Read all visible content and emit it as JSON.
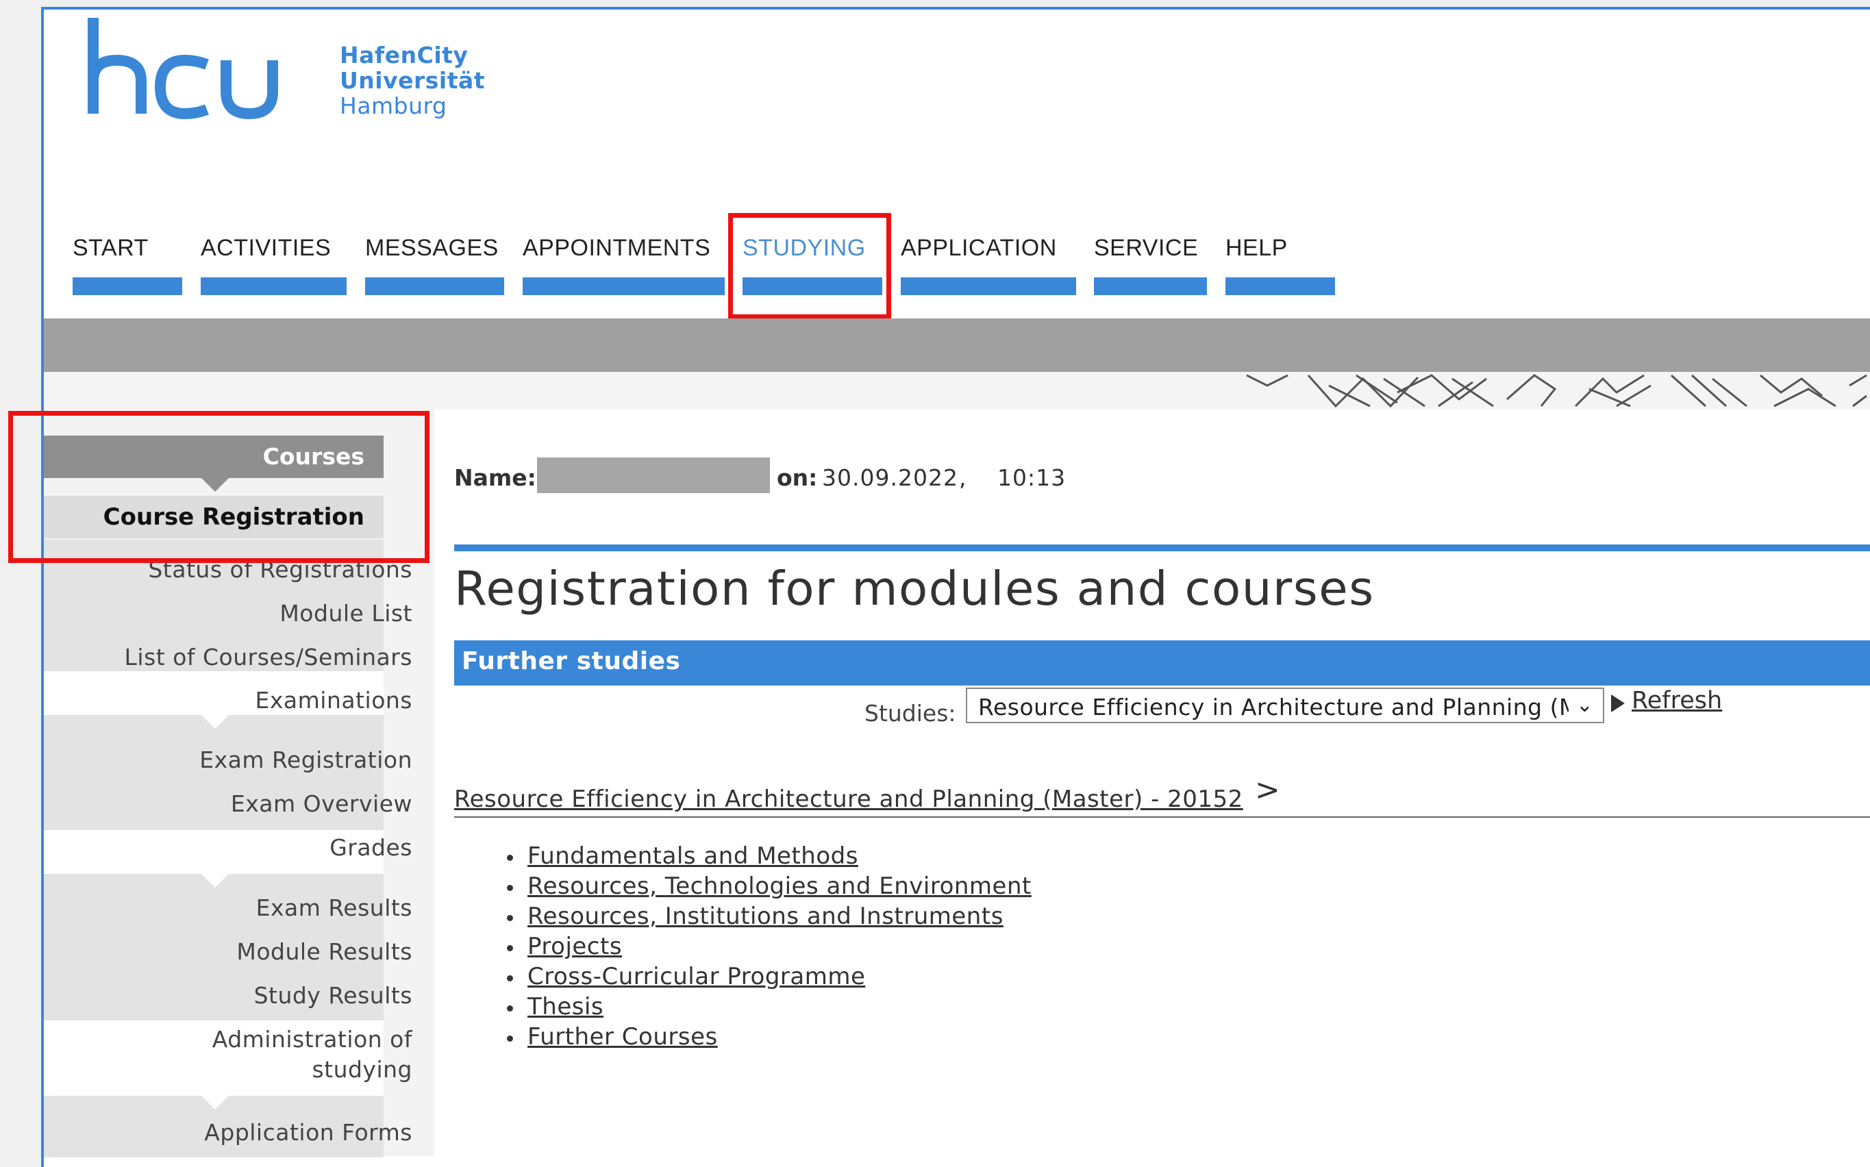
{
  "logo": {
    "mark": "hcu",
    "line1": "HafenCity",
    "line2": "Universität",
    "line3": "Hamburg"
  },
  "nav": {
    "items": [
      {
        "label": "START"
      },
      {
        "label": "ACTIVITIES"
      },
      {
        "label": "MESSAGES"
      },
      {
        "label": "APPOINTMENTS"
      },
      {
        "label": "STUDYING"
      },
      {
        "label": "APPLICATION"
      },
      {
        "label": "SERVICE"
      },
      {
        "label": "HELP"
      }
    ],
    "active": "STUDYING"
  },
  "sidebar": {
    "courses_header": "Courses",
    "course_registration": "Course Registration",
    "status_of_registrations": "Status of Registrations",
    "module_list": "Module List",
    "list_of_courses": "List of Courses/Seminars",
    "examinations": "Examinations",
    "exam_registration": "Exam Registration",
    "exam_overview": "Exam Overview",
    "grades": "Grades",
    "exam_results": "Exam Results",
    "module_results": "Module Results",
    "study_results": "Study Results",
    "admin_line1": "Administration of",
    "admin_line2": "studying",
    "application_forms": "Application Forms"
  },
  "main": {
    "name_label": "Name:",
    "on_label": "on:",
    "date": "30.09.2022",
    "time": "10:13",
    "title": "Registration for modules and courses",
    "section_label": "Further studies",
    "studies_label": "Studies:",
    "studies_value": "Resource Efficiency in Architecture and Planning (Master)",
    "refresh_label": "Refresh",
    "program_link": "Resource Efficiency in Architecture and Planning (Master) - 20152",
    "program_chevron": ">",
    "modules": [
      "Fundamentals and Methods",
      "Resources, Technologies and Environment",
      "Resources, Institutions and Instruments",
      "Projects",
      "Cross-Curricular Programme",
      "Thesis",
      "Further Courses"
    ]
  },
  "colors": {
    "accent": "#3a87d8",
    "highlight": "#ee1111",
    "band": "#a0a0a0"
  }
}
